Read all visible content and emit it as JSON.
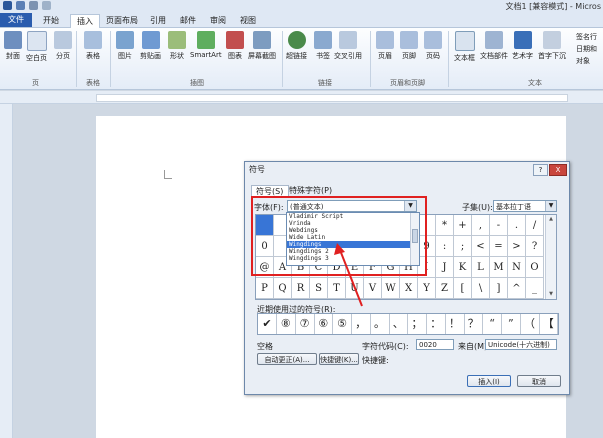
{
  "app": {
    "title": "文档1 [兼容模式] - Micros"
  },
  "tabs": [
    {
      "label": "文件",
      "active": false
    },
    {
      "label": "开始",
      "active": false
    },
    {
      "label": "插入",
      "active": true
    },
    {
      "label": "页面布局",
      "active": false
    },
    {
      "label": "引用",
      "active": false
    },
    {
      "label": "邮件",
      "active": false
    },
    {
      "label": "审阅",
      "active": false
    },
    {
      "label": "视图",
      "active": false
    }
  ],
  "ribbon": {
    "buttons": [
      "封面",
      "空白页",
      "分页",
      "表格",
      "图片",
      "剪贴画",
      "形状",
      "SmartArt",
      "图表",
      "屏幕截图",
      "超链接",
      "书签",
      "交叉引用",
      "页眉",
      "页脚",
      "页码",
      "文本框",
      "文档部件",
      "艺术字",
      "首字下沉"
    ],
    "groups": [
      "页",
      "表格",
      "插图",
      "链接",
      "页眉和页脚",
      "文本"
    ],
    "side_items": [
      "签名行",
      "日期和",
      "对象"
    ]
  },
  "dialog": {
    "title": "符号",
    "help": "?",
    "close": "X",
    "tab_symbols": "符号(S)",
    "tab_special": "特殊字符(P)",
    "font_label": "字体(F):",
    "font_value": "(普通文本)",
    "subset_label": "子集(U):",
    "subset_value": "基本拉丁语",
    "font_list": [
      "Vladimir Script",
      "Vrinda",
      "Webdings",
      "Wide Latin",
      "Wingdings",
      "Wingdings 2",
      "Wingdings 3"
    ],
    "font_list_highlight": "Wingdings",
    "symbol_rows": [
      [
        "",
        "",
        "",
        "",
        "",
        "",
        "",
        "",
        "",
        "",
        "*",
        "+",
        ",",
        "-",
        ".",
        "/"
      ],
      [
        "0",
        "",
        "",
        "",
        "",
        "",
        "",
        "",
        "",
        "9",
        ":",
        ";",
        "<",
        "=",
        ">",
        "?"
      ],
      [
        "@",
        "A",
        "B",
        "C",
        "D",
        "E",
        "F",
        "G",
        "H",
        "I",
        "J",
        "K",
        "L",
        "M",
        "N",
        "O"
      ],
      [
        "P",
        "Q",
        "R",
        "S",
        "T",
        "U",
        "V",
        "W",
        "X",
        "Y",
        "Z",
        "[",
        "\\",
        "]",
        "^",
        "_"
      ]
    ],
    "recent_label": "近期使用过的符号(R):",
    "recent_symbols": [
      "✔",
      "⑧",
      "⑦",
      "⑥",
      "⑤",
      "，",
      "。",
      "、",
      "；",
      "：",
      "！",
      "？",
      "“",
      "”",
      "（",
      "【"
    ],
    "char_name": "空格",
    "code_label": "字符代码(C):",
    "code_value": "0020",
    "from_label": "来自(M):",
    "from_value": "Unicode(十六进制)",
    "autocorrect_button": "自动更正(A)...",
    "shortcut_button": "快捷键(K)...",
    "shortcut_label": "快捷键:",
    "insert_button": "插入(I)",
    "cancel_button": "取消"
  },
  "colors": {
    "file_tab": "#2a5cae",
    "selection": "#3875d6",
    "annotation": "#e02020"
  }
}
